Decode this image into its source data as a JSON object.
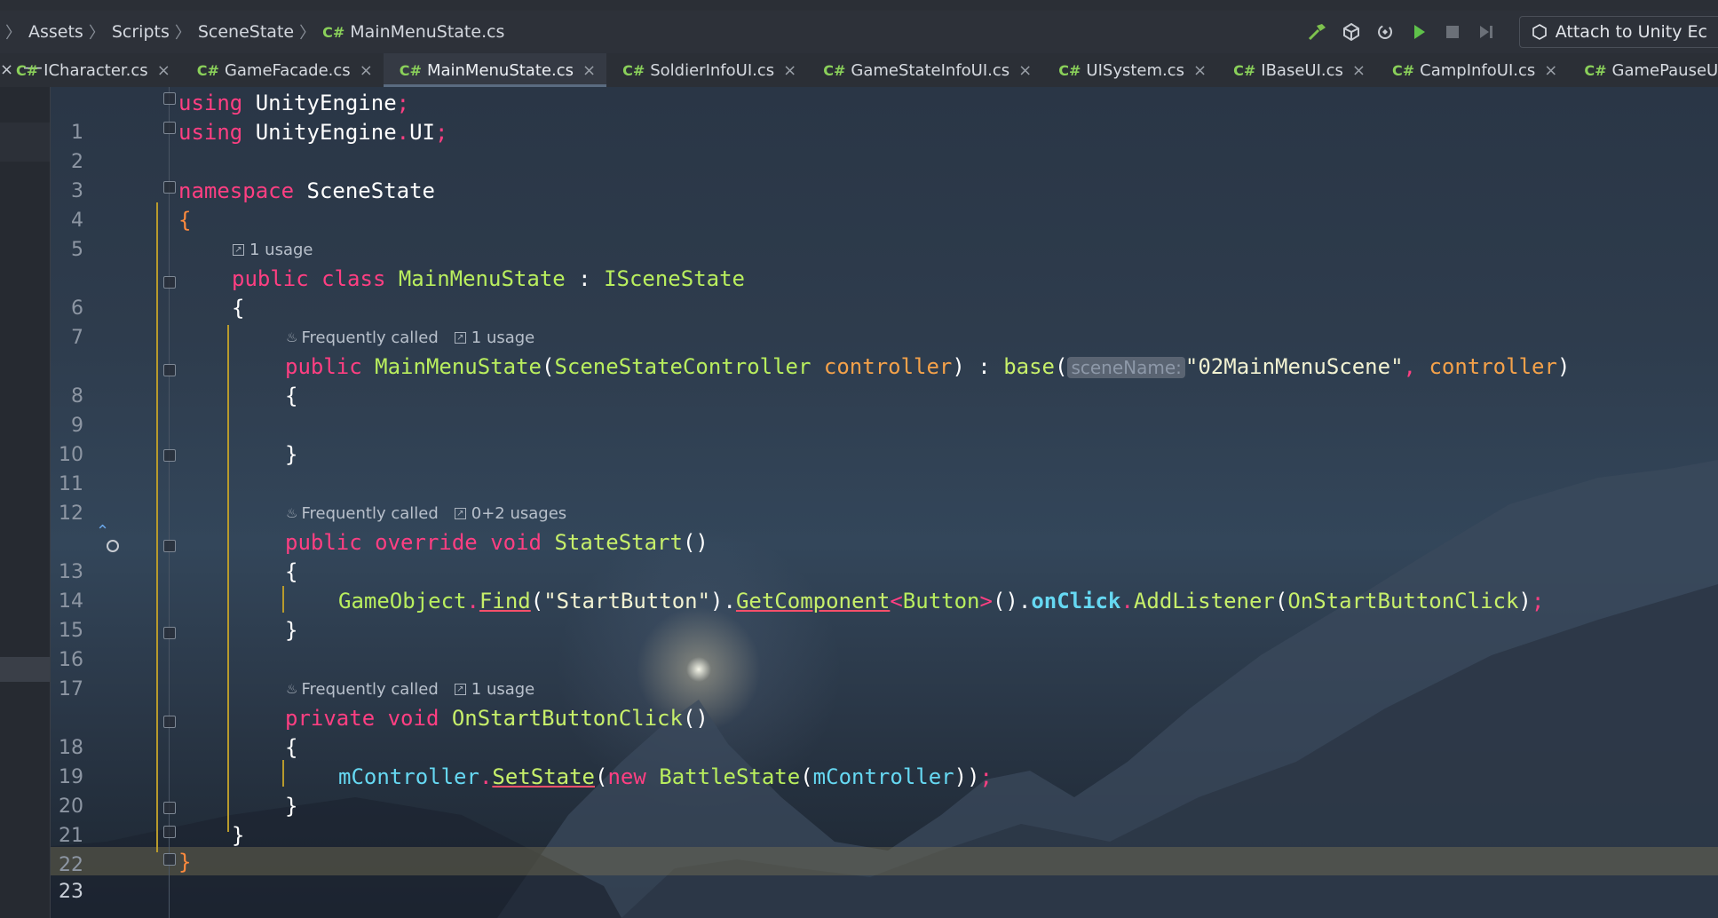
{
  "breadcrumb": {
    "items": [
      "Assets",
      "Scripts",
      "SceneState"
    ],
    "file_badge": "C#",
    "file": "MainMenuState.cs"
  },
  "toolbar": {
    "icons": [
      "build-hammer-icon",
      "unity-icon",
      "refresh-unity-icon",
      "run-play-icon",
      "stop-icon",
      "step-icon"
    ],
    "attach_label": "Attach to Unity Ec"
  },
  "tabs": [
    {
      "badge": "C#",
      "label": "ICharacter.cs",
      "active": false
    },
    {
      "badge": "C#",
      "label": "GameFacade.cs",
      "active": false
    },
    {
      "badge": "C#",
      "label": "MainMenuState.cs",
      "active": true
    },
    {
      "badge": "C#",
      "label": "SoldierInfoUI.cs",
      "active": false
    },
    {
      "badge": "C#",
      "label": "GameStateInfoUI.cs",
      "active": false
    },
    {
      "badge": "C#",
      "label": "UISystem.cs",
      "active": false
    },
    {
      "badge": "C#",
      "label": "IBaseUI.cs",
      "active": false
    },
    {
      "badge": "C#",
      "label": "CampInfoUI.cs",
      "active": false
    },
    {
      "badge": "C#",
      "label": "GamePauseUI.cs",
      "active": false
    }
  ],
  "tab_close_glyph": "×",
  "hints": {
    "h1": {
      "usage": "1 usage"
    },
    "h2": {
      "freq": "Frequently called",
      "usage": "1 usage"
    },
    "h3": {
      "freq": "Frequently called",
      "usage": "0+2 usages"
    },
    "h4": {
      "freq": "Frequently called",
      "usage": "1 usage"
    }
  },
  "line_numbers": [
    "1",
    "2",
    "3",
    "4",
    "5",
    "6",
    "7",
    "8",
    "9",
    "10",
    "11",
    "12",
    "13",
    "14",
    "15",
    "16",
    "17",
    "18",
    "19",
    "20",
    "21",
    "22",
    "23"
  ],
  "code": {
    "l1": [
      "using",
      " UnityEngine",
      ";"
    ],
    "l2": [
      "using",
      " UnityEngine",
      ".",
      "UI",
      ";"
    ],
    "l4": [
      "namespace",
      " SceneState"
    ],
    "l5": [
      "{"
    ],
    "l6": [
      "public",
      " ",
      "class",
      " ",
      "MainMenuState",
      " : ",
      "ISceneState"
    ],
    "l7": [
      "{"
    ],
    "l8": [
      "public",
      " ",
      "MainMenuState",
      "(",
      "SceneStateController",
      " ",
      "controller",
      ") : ",
      "base",
      "(",
      "sceneName:",
      "\"02MainMenuScene\"",
      ", ",
      "controller",
      ")"
    ],
    "l9": [
      "{"
    ],
    "l11": [
      "}"
    ],
    "l13": [
      "public",
      " ",
      "override",
      " ",
      "void",
      " ",
      "StateStart",
      "()"
    ],
    "l14": [
      "{"
    ],
    "l15": [
      "GameObject",
      ".",
      "Find",
      "(",
      "\"StartButton\"",
      ").",
      "GetComponent",
      "<",
      "Button",
      ">",
      "().",
      "onClick",
      ".",
      "AddListener",
      "(",
      "OnStartButtonClick",
      ")",
      ";"
    ],
    "l16": [
      "}"
    ],
    "l18": [
      "private",
      " ",
      "void",
      " ",
      "OnStartButtonClick",
      "()"
    ],
    "l19": [
      "{"
    ],
    "l20": [
      "mController",
      ".",
      "SetState",
      "(",
      "new",
      " ",
      "BattleState",
      "(",
      "mController",
      "))",
      ";"
    ],
    "l21": [
      "}"
    ],
    "l22": [
      "}"
    ],
    "l23": [
      "}"
    ]
  },
  "colors": {
    "keyword": "#ff3f82",
    "type": "#b9ee5e",
    "parameter": "#f5a24a",
    "field": "#66d8f2",
    "current_line": "#5c5744"
  }
}
